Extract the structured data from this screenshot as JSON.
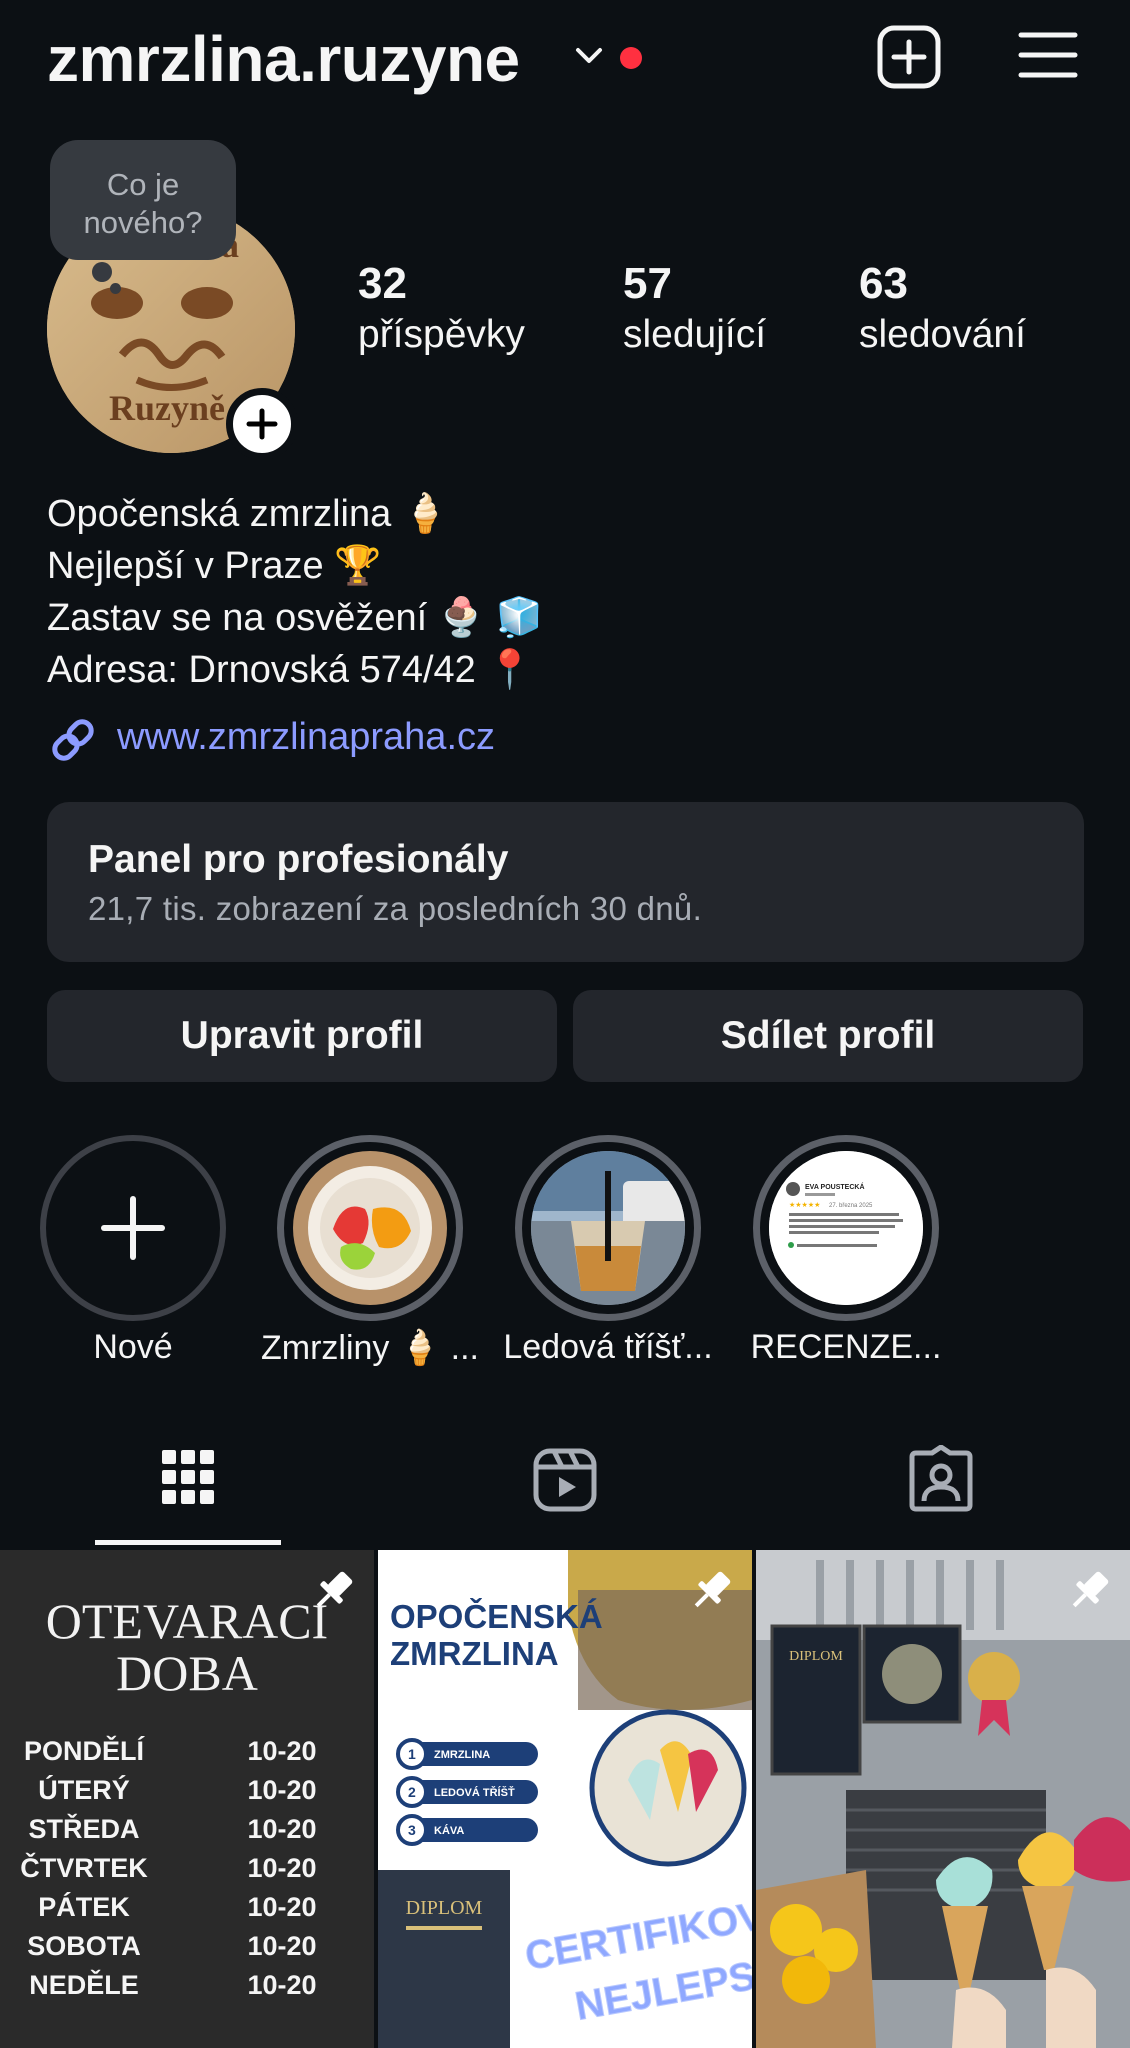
{
  "header": {
    "username": "zmrzlina.ruzyne"
  },
  "note": {
    "text": "Co je nového?"
  },
  "avatar": {
    "logo_top": "zmrzlina",
    "logo_bottom": "Ruzyně"
  },
  "stats": [
    {
      "value": "32",
      "label": "příspěvky"
    },
    {
      "value": "57",
      "label": "sledující"
    },
    {
      "value": "63",
      "label": "sledování"
    }
  ],
  "bio": {
    "lines": [
      "Opočenská zmrzlina 🍦",
      "Nejlepší v Praze 🏆",
      "Zastav se na osvěžení 🍨 🧊",
      "Adresa: Drnovská 574/42 📍"
    ],
    "link": "www.zmrzlinapraha.cz"
  },
  "pro_panel": {
    "title": "Panel pro profesionály",
    "subtitle": "21,7 tis. zobrazení za posledních 30 dnů."
  },
  "buttons": {
    "edit": "Upravit profil",
    "share": "Sdílet profil"
  },
  "highlights": [
    {
      "label": "Nové"
    },
    {
      "label": "Zmrzliny 🍦 ..."
    },
    {
      "label": "Ledová tříšť..."
    },
    {
      "label": "RECENZE..."
    }
  ],
  "review_card": {
    "name": "EVA POUSTECKÁ",
    "date": "27. března 2025"
  },
  "grid": {
    "post1": {
      "title1": "OTEVARACI",
      "title2": "DOBA",
      "rows": [
        {
          "day": "PONDĚLÍ",
          "hours": "10-20"
        },
        {
          "day": "ÚTERÝ",
          "hours": "10-20"
        },
        {
          "day": "STŘEDA",
          "hours": "10-20"
        },
        {
          "day": "ČTVRTEK",
          "hours": "10-20"
        },
        {
          "day": "PÁTEK",
          "hours": "10-20"
        },
        {
          "day": "SOBOTA",
          "hours": "10-20"
        },
        {
          "day": "NEDĚLE",
          "hours": "10-20"
        }
      ]
    },
    "post2": {
      "title1": "OPOČENSKÁ",
      "title2": "ZMRZLINA",
      "items": [
        "ZMRZLINA",
        "LEDOVÁ TŘÍŠŤ",
        "KÁVA"
      ],
      "diploma": "DIPLOM",
      "badge1": "CERTIFIKOVANĚ",
      "badge2": "NEJLEPSI"
    },
    "post3": {
      "diploma": "DIPLOM"
    }
  },
  "colors": {
    "background": "#0c1014",
    "surface": "#23262c",
    "link": "#8c9bff",
    "notification": "#ff3040"
  }
}
